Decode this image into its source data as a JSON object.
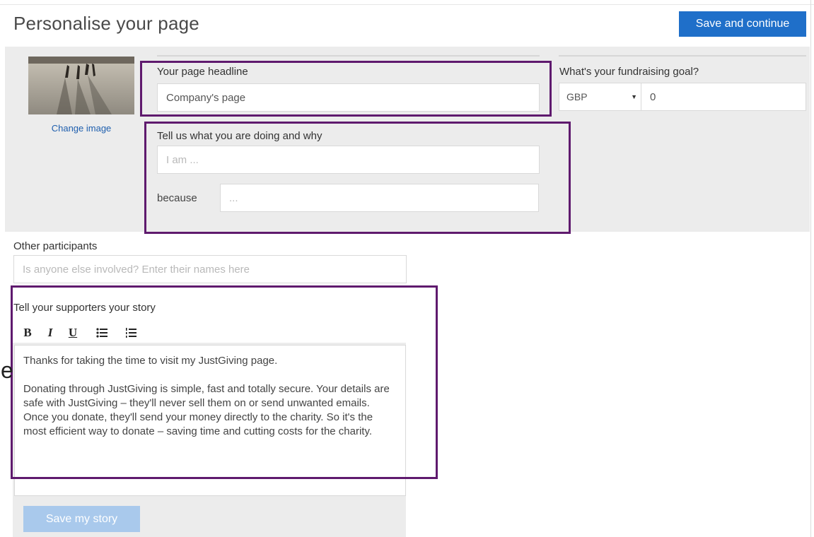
{
  "header": {
    "title": "Personalise your page",
    "save_continue_label": "Save and continue"
  },
  "image_panel": {
    "change_image_label": "Change image"
  },
  "headline": {
    "label": "Your page headline",
    "value": "Company's page"
  },
  "goal": {
    "label": "What's your fundraising goal?",
    "currency": "GBP",
    "amount": "0"
  },
  "reason": {
    "label": "Tell us what you are doing and why",
    "i_am_placeholder": "I am ...",
    "because_label": "because",
    "because_placeholder": "..."
  },
  "participants": {
    "label": "Other participants",
    "placeholder": "Is anyone else involved? Enter their names here"
  },
  "story": {
    "label": "Tell your supporters your story",
    "toolbar": {
      "bold": "B",
      "italic": "I",
      "underline": "U"
    },
    "paragraphs": [
      "Thanks for taking the time to visit my JustGiving page.",
      "Donating through JustGiving is simple, fast and totally secure. Your details are safe with JustGiving – they'll never sell them on or send unwanted emails. Once you donate, they'll send your money directly to the charity. So it's the most efficient way to donate – saving time and cutting costs for the charity."
    ],
    "save_label": "Save my story"
  },
  "stray_glyph": "e",
  "colors": {
    "primary_button": "#1f6fc9",
    "disabled_button": "#a9c9ec",
    "highlight_frame": "#5f1a6e",
    "panel_background": "#ececec"
  }
}
